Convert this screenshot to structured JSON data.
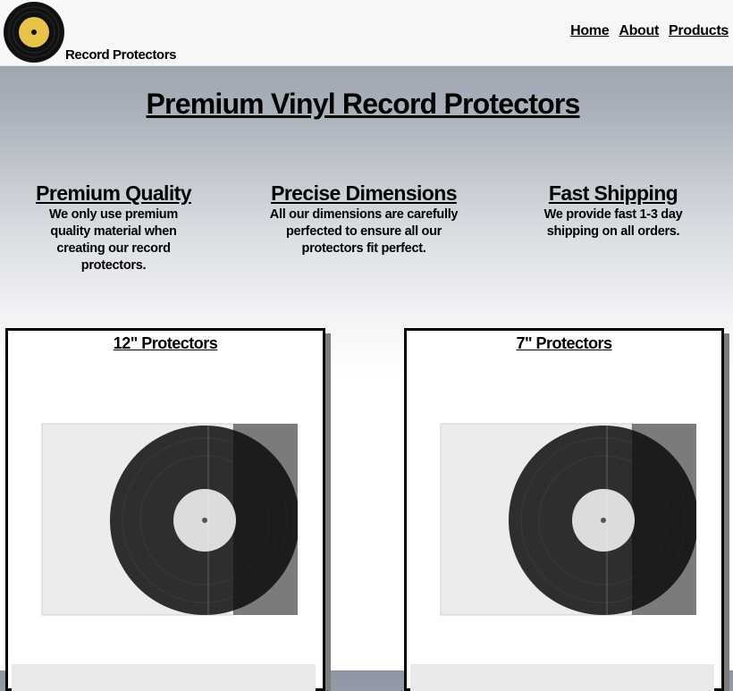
{
  "header": {
    "brand": "Record Protectors",
    "logo_icon": "vinyl-record-icon",
    "nav": [
      "Home",
      "About",
      "Products"
    ]
  },
  "hero": {
    "title": "Premium Vinyl Record Protectors"
  },
  "features": [
    {
      "title": "Premium Quality",
      "text": "We only use premium quality material when creating our record protectors."
    },
    {
      "title": "Precise Dimensions",
      "text": "All our dimensions are carefully perfected to ensure all our protectors fit perfect."
    },
    {
      "title": "Fast Shipping",
      "text": "We provide fast 1-3 day shipping on all orders."
    }
  ],
  "products": [
    {
      "title": "12\" Protectors",
      "image_icon": "record-sleeve-image"
    },
    {
      "title": "7\" Protectors",
      "image_icon": "record-sleeve-image"
    }
  ],
  "colors": {
    "logo_label": "#e8c24a",
    "card_shadow": "#7c7c7c"
  }
}
